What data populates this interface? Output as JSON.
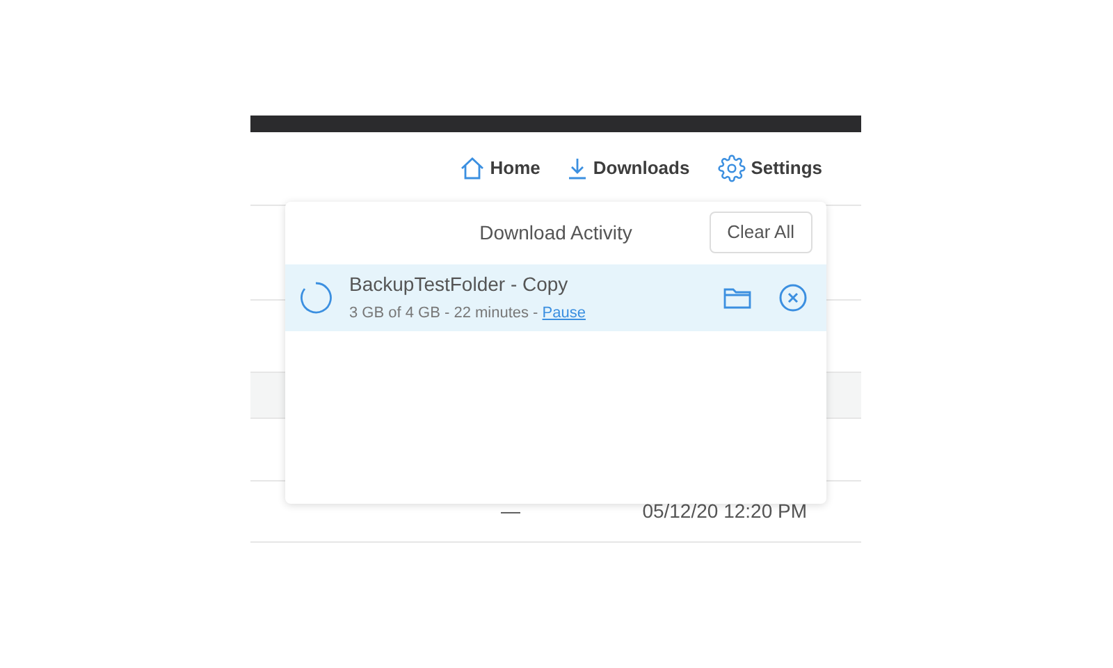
{
  "nav": [
    {
      "label": "Home"
    },
    {
      "label": "Downloads"
    },
    {
      "label": "Settings"
    }
  ],
  "download_panel": {
    "title": "Download Activity",
    "clear_button": "Clear All",
    "items": [
      {
        "name": "BackupTestFolder - Copy",
        "progress_text": "3 GB of 4 GB - 22 minutes - ",
        "action_link": "Pause"
      }
    ]
  },
  "table_rows": [
    {
      "cells": [
        "—",
        "05/12/20 12:20 PM"
      ]
    }
  ]
}
